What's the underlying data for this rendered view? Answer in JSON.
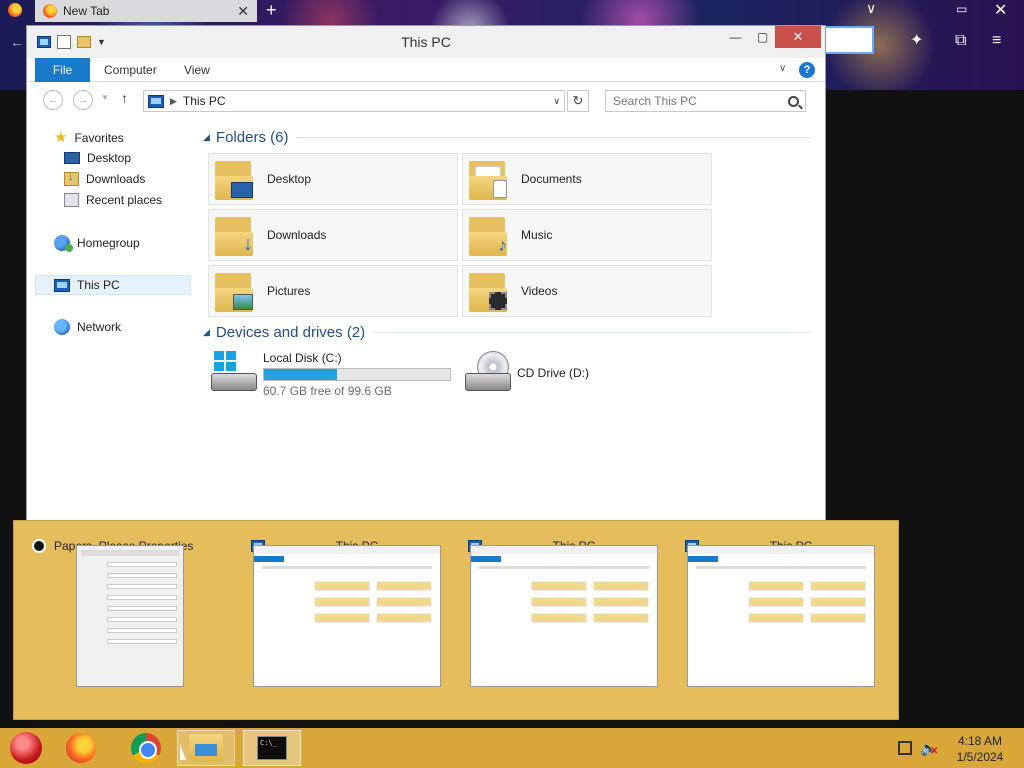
{
  "browser": {
    "tab_title": "New Tab",
    "tab_close": "✕",
    "new_tab": "+",
    "tabs_menu": "∨",
    "restore": "▭",
    "close": "✕",
    "extensions": "⧉",
    "menu": "≡",
    "back": "←"
  },
  "window": {
    "title": "This PC",
    "minimize": "—",
    "maximize": "▢",
    "close": "✕"
  },
  "ribbon": {
    "tabs": [
      "File",
      "Computer",
      "View"
    ],
    "help": "?"
  },
  "navigation": {
    "back": "←",
    "forward": "→",
    "up": "↑",
    "address": "This PC",
    "refresh": "↻",
    "search_placeholder": "Search This PC"
  },
  "nav_pane": {
    "favorites": "Favorites",
    "desktop": "Desktop",
    "downloads": "Downloads",
    "recent": "Recent places",
    "homegroup": "Homegroup",
    "this_pc": "This PC",
    "network": "Network"
  },
  "content": {
    "folders_header": "Folders (6)",
    "folders": [
      "Desktop",
      "Documents",
      "Downloads",
      "Music",
      "Pictures",
      "Videos"
    ],
    "devices_header": "Devices and drives (2)",
    "drives": [
      {
        "name": "Local Disk (C:)",
        "free": "60.7 GB free of 99.6 GB",
        "used_fraction": 0.39
      },
      {
        "name": "CD Drive (D:)"
      }
    ]
  },
  "previews": [
    {
      "title": "Papers, Please Properties"
    },
    {
      "title": "This PC"
    },
    {
      "title": "This PC"
    },
    {
      "title": "This PC"
    }
  ],
  "taskbar": {
    "time": "4:18 AM",
    "date": "1/5/2024",
    "cmd_text": "C:\\_"
  },
  "colors": {
    "accent": "#1979ca",
    "taskbar": "#d9a63a",
    "preview_strip": "#e6bd5d",
    "drive_fill": "#26a0da"
  }
}
